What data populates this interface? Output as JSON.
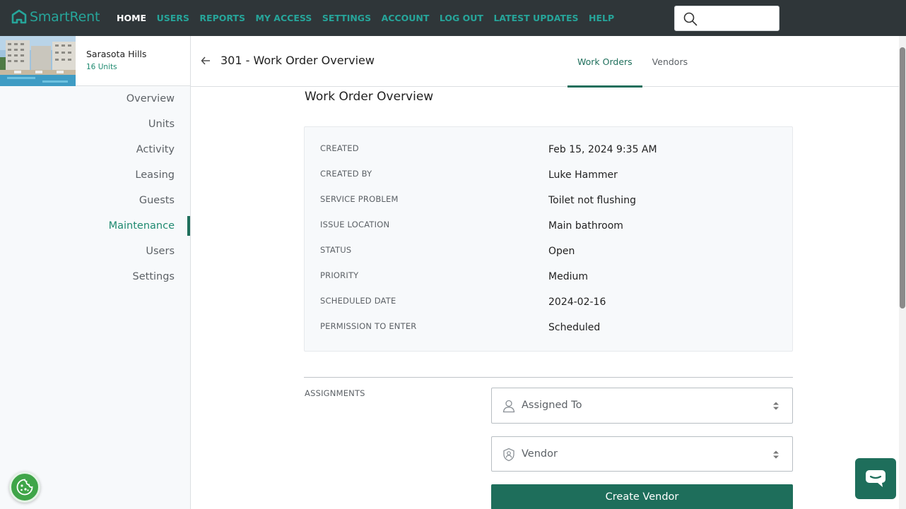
{
  "brand": {
    "name": "SmartRent",
    "accent": "#26a59a",
    "primary": "#1e6e5b"
  },
  "topnav": {
    "items": [
      {
        "label": "HOME",
        "active": true
      },
      {
        "label": "USERS"
      },
      {
        "label": "REPORTS"
      },
      {
        "label": "MY ACCESS"
      },
      {
        "label": "SETTINGS"
      },
      {
        "label": "ACCOUNT"
      },
      {
        "label": "LOG OUT"
      },
      {
        "label": "LATEST UPDATES"
      },
      {
        "label": "HELP"
      }
    ],
    "search": {
      "placeholder": "",
      "value": "",
      "icon": "search-icon"
    }
  },
  "property": {
    "name": "Sarasota Hills",
    "units": "16 Units"
  },
  "sidebar": {
    "items": [
      {
        "label": "Overview"
      },
      {
        "label": "Units"
      },
      {
        "label": "Activity"
      },
      {
        "label": "Leasing"
      },
      {
        "label": "Guests"
      },
      {
        "label": "Maintenance",
        "active": true
      },
      {
        "label": "Users"
      },
      {
        "label": "Settings"
      }
    ]
  },
  "header": {
    "title": "301 - Work Order Overview",
    "tabs": [
      {
        "label": "Work Orders",
        "active": true
      },
      {
        "label": "Vendors"
      }
    ]
  },
  "main": {
    "section_title": "Work Order Overview",
    "details": [
      {
        "label": "CREATED",
        "value": "Feb 15, 2024 9:35 AM"
      },
      {
        "label": "CREATED BY",
        "value": "Luke Hammer"
      },
      {
        "label": "SERVICE PROBLEM",
        "value": "Toilet not flushing"
      },
      {
        "label": "ISSUE LOCATION",
        "value": "Main bathroom"
      },
      {
        "label": "STATUS",
        "value": "Open"
      },
      {
        "label": "PRIORITY",
        "value": "Medium"
      },
      {
        "label": "SCHEDULED DATE",
        "value": "2024-02-16"
      },
      {
        "label": "PERMISSION TO ENTER",
        "value": "Scheduled"
      }
    ],
    "assignments": {
      "label": "ASSIGNMENTS",
      "assigned_to": {
        "placeholder": "Assigned To",
        "icon": "user-icon"
      },
      "vendor": {
        "placeholder": "Vendor",
        "icon": "shield-user-icon"
      },
      "create_vendor_label": "Create Vendor"
    }
  }
}
